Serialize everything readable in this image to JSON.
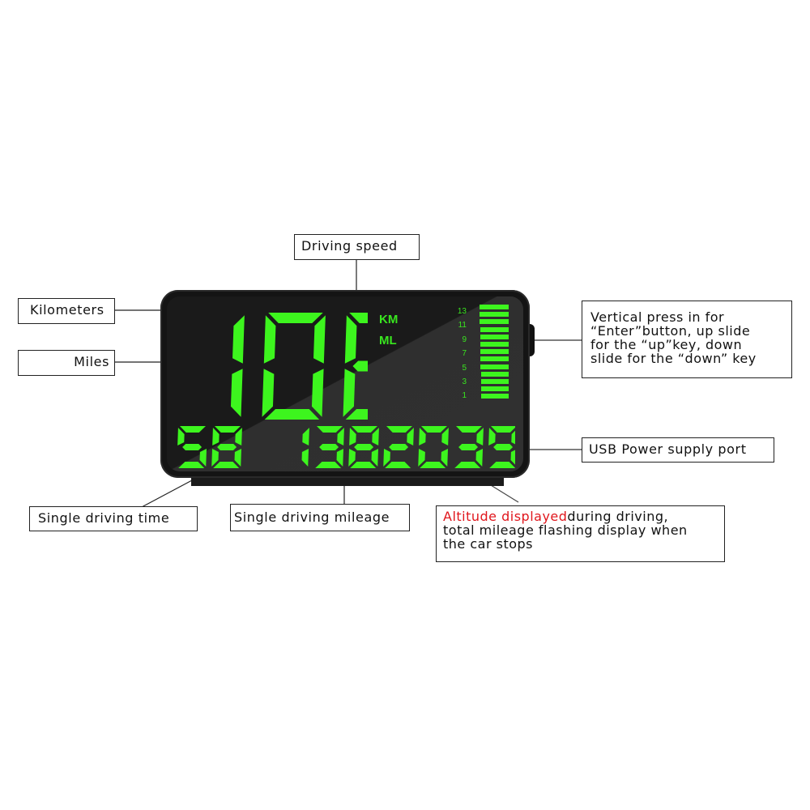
{
  "device": {
    "speed": "108",
    "units": [
      "KM",
      "ML"
    ],
    "bar_scale": [
      "13",
      "11",
      "9",
      "7",
      "5",
      "3",
      "1"
    ],
    "bar_count": 13,
    "bar_level_filled": 13,
    "single_driving_time": "58",
    "single_driving_mileage": "138",
    "altitude_total": "2039",
    "segment_color": "#3df51e"
  },
  "callouts": {
    "driving_speed": "Driving speed",
    "kilometers": "Kilometers",
    "miles": "Miles",
    "button": {
      "lines": [
        "Vertical press in for",
        "“Enter”button,  up slide",
        "for the “up”key,  down",
        "slide for the “down” key"
      ]
    },
    "usb_port": "USB Power supply port",
    "single_driving_time": "Single driving time",
    "single_driving_mileage": "Single driving mileage",
    "altitude": {
      "highlight": "Altitude displayed",
      "rest_line1": "during driving,",
      "line2": "total mileage flashing display when",
      "line3": "the car stops",
      "highlight_color": "#e0161c"
    }
  }
}
